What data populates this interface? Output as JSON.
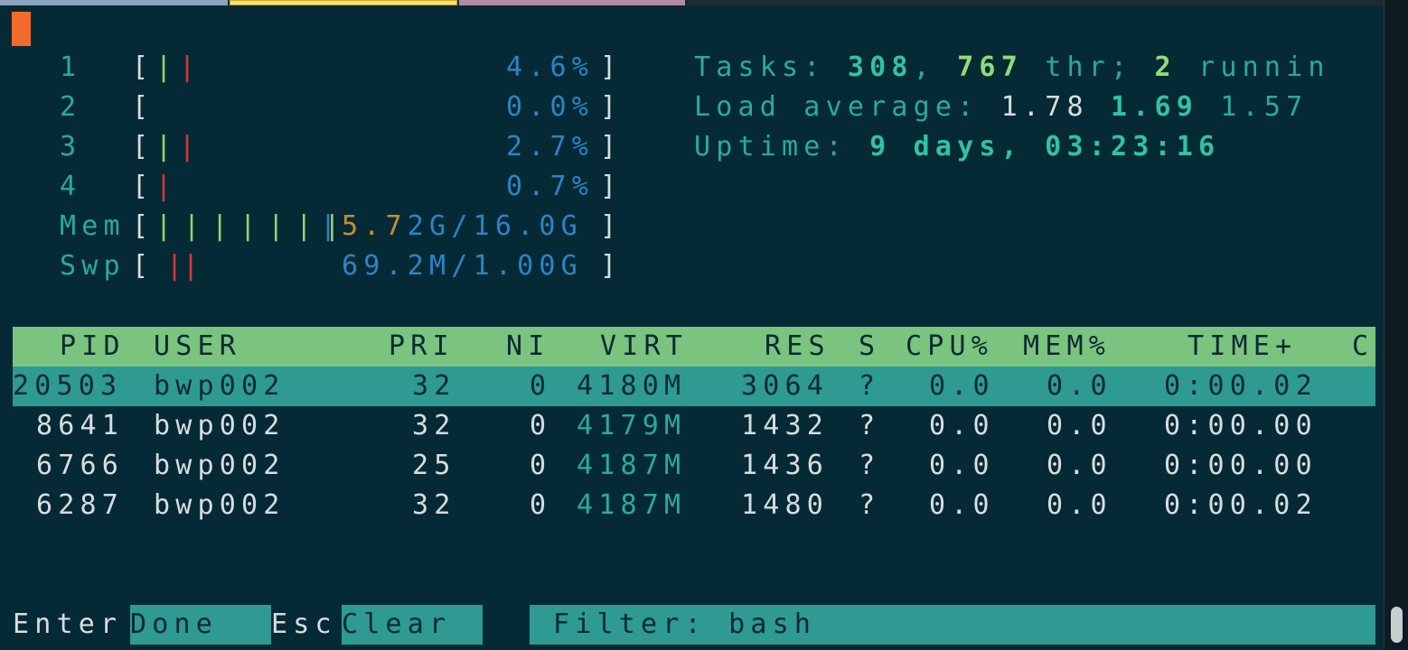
{
  "cpus": [
    {
      "id": "1",
      "bars": [
        {
          "c": "g",
          "ch": "|"
        },
        {
          "c": "r",
          "ch": "|"
        }
      ],
      "pct": "4.6%"
    },
    {
      "id": "2",
      "bars": [],
      "pct": "0.0%"
    },
    {
      "id": "3",
      "bars": [
        {
          "c": "g",
          "ch": "|"
        },
        {
          "c": "r",
          "ch": "|"
        }
      ],
      "pct": "2.7%"
    },
    {
      "id": "4",
      "bars": [
        {
          "c": "r",
          "ch": "|"
        }
      ],
      "pct": "0.7%"
    }
  ],
  "mem": {
    "label": "Mem",
    "value_a": "5.7",
    "value_b": "2G/16.0G"
  },
  "swp": {
    "label": "Swp",
    "value": "69.2M/1.00G"
  },
  "tasks": {
    "label": "Tasks: ",
    "count": "308",
    "sep": ", ",
    "threads": "767",
    "thr_label": " thr; ",
    "running": "2",
    "running_label": " runnin"
  },
  "load": {
    "label": "Load average: ",
    "one": "1.78",
    "five": "1.69",
    "fifteen": "1.57"
  },
  "uptime": {
    "label": "Uptime: ",
    "value": "9 days, 03:23:16"
  },
  "columns": [
    "PID",
    "USER",
    "PRI",
    "NI",
    "VIRT",
    "RES",
    "S",
    "CPU%",
    "MEM%",
    "TIME+",
    "C"
  ],
  "processes": [
    {
      "pid": "20503",
      "user": "bwp002",
      "pri": "32",
      "ni": "0",
      "virt": "4180M",
      "res": "3064",
      "s": "?",
      "cpu": "0.0",
      "mem": "0.0",
      "time": "0:00.02",
      "selected": true
    },
    {
      "pid": "8641",
      "user": "bwp002",
      "pri": "32",
      "ni": "0",
      "virt": "4179M",
      "res": "1432",
      "s": "?",
      "cpu": "0.0",
      "mem": "0.0",
      "time": "0:00.00",
      "selected": false
    },
    {
      "pid": "6766",
      "user": "bwp002",
      "pri": "25",
      "ni": "0",
      "virt": "4187M",
      "res": "1436",
      "s": "?",
      "cpu": "0.0",
      "mem": "0.0",
      "time": "0:00.00",
      "selected": false
    },
    {
      "pid": "6287",
      "user": "bwp002",
      "pri": "32",
      "ni": "0",
      "virt": "4187M",
      "res": "1480",
      "s": "?",
      "cpu": "0.0",
      "mem": "0.0",
      "time": "0:00.02",
      "selected": false
    }
  ],
  "footer": {
    "enter_key": "Enter",
    "enter_label": "Done",
    "esc_key": "Esc",
    "esc_label": "Clear",
    "filter_label": "Filter: ",
    "filter_value": "bash"
  },
  "colors": {
    "background": "#062a35",
    "header_bg": "#7bc47f",
    "selection_bg": "#2e9a92",
    "cursor": "#f26b2a"
  }
}
